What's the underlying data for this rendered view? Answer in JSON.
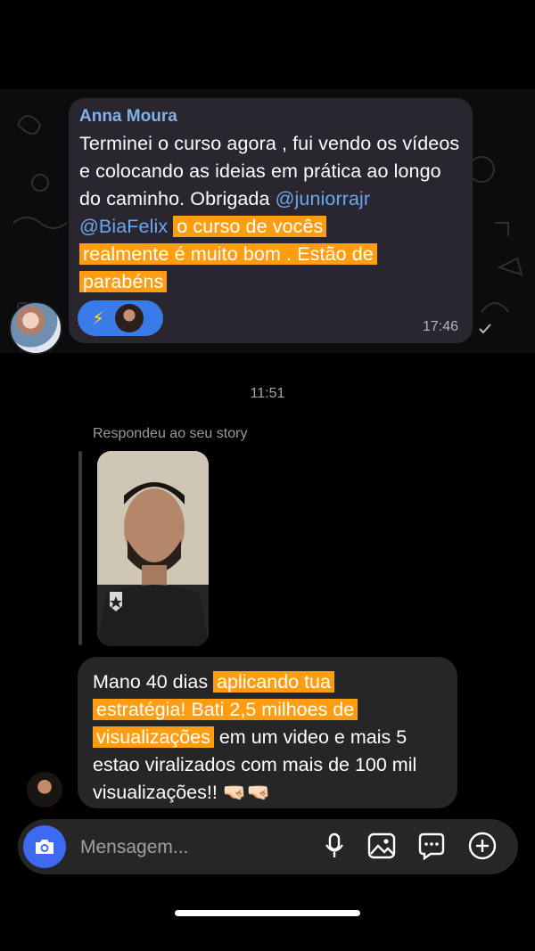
{
  "telegram_message": {
    "sender": "Anna Moura",
    "text_plain": "Terminei o curso agora , fui vendo os vídeos e colocando as ideias em prática ao longo do caminho. Obrigada ",
    "mention_1": "@juniorrajr",
    "mention_2": "@BiaFelix",
    "highlight_1": "o curso de vocês",
    "highlight_2": "realmente é muito bom . Estão de",
    "highlight_3": "parabéns",
    "reaction_icon": "⚡",
    "time": "17:46"
  },
  "chat": {
    "timestamp": "11:51",
    "story_reply_label": "Respondeu ao seu story"
  },
  "dm_message": {
    "text_1": "Mano 40 dias ",
    "highlight_1": "aplicando tua",
    "highlight_2": "estratégia! Bati 2,5 milhoes de",
    "highlight_3": "visualizações",
    "text_2": " em um video e mais 5 estao viralizados com mais de 100 mil visualizações!! ",
    "emoji": "🤜🏻🤜🏻"
  },
  "composer": {
    "placeholder": "Mensagem..."
  },
  "icons": {
    "camera": "camera-icon",
    "mic": "microphone-icon",
    "gallery": "image-icon",
    "sticker": "sticker-chat-icon",
    "add": "plus-circle-icon"
  },
  "colors": {
    "highlight": "#ff9d12",
    "mention": "#6aa8ee",
    "sender": "#7fb3ec",
    "camera_button": "#3d6af0"
  }
}
